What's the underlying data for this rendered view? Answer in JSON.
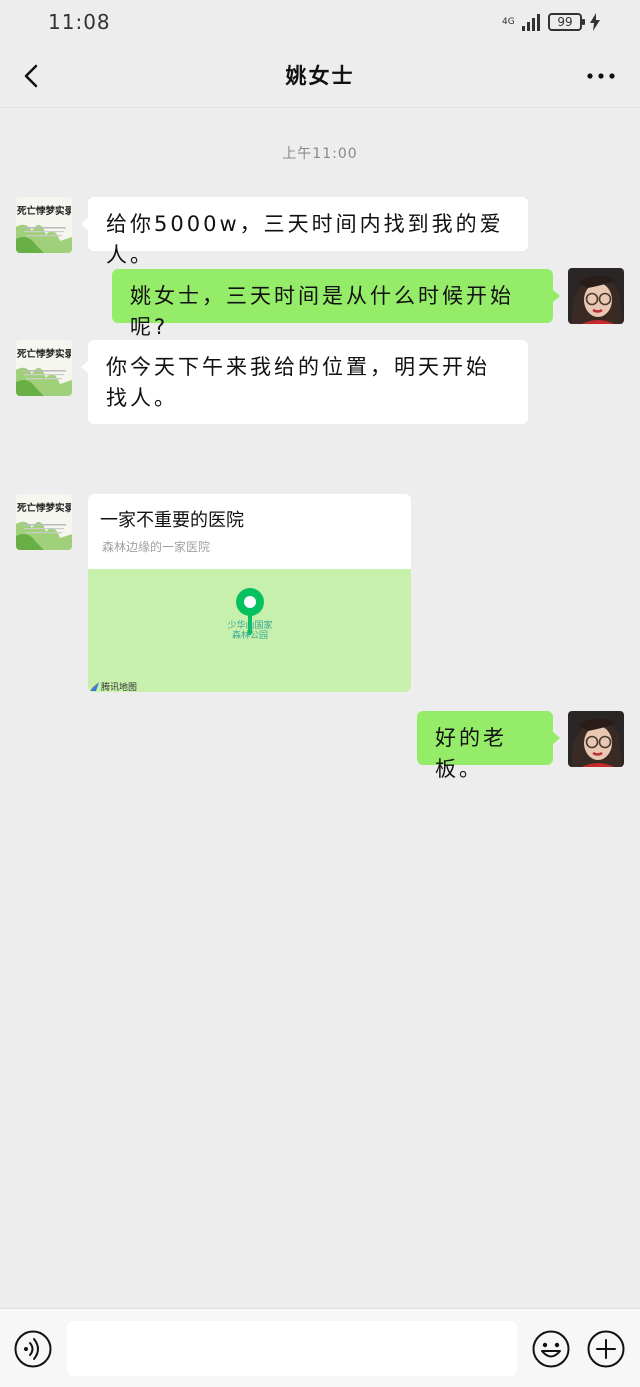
{
  "status_bar": {
    "time": "11:08",
    "network": "4G",
    "battery": "99"
  },
  "header": {
    "title": "姚女士"
  },
  "timestamp": "上午11:00",
  "messages": [
    {
      "side": "left",
      "avatar": "book-cover-avatar",
      "text": "给你5000w，三天时间内找到我的爱人。"
    },
    {
      "side": "right",
      "avatar": "user-avatar",
      "text": "姚女士，三天时间是从什么时候开始呢?"
    },
    {
      "side": "left",
      "avatar": "book-cover-avatar",
      "text": "你今天下午来我给的位置，明天开始找人。"
    },
    {
      "side": "left",
      "avatar": "book-cover-avatar",
      "type": "location",
      "location": {
        "title": "一家不重要的医院",
        "subtitle": "森林边缘的一家医院",
        "map_label": "少华山国家森林公园",
        "map_brand": "腾讯地图"
      }
    },
    {
      "side": "right",
      "avatar": "user-avatar",
      "text": "好的老板。"
    }
  ],
  "book_cover": {
    "title": "死亡悖梦实录"
  },
  "colors": {
    "green_bubble": "#95ec69",
    "background": "#ededed",
    "pin": "#07c160"
  },
  "input": {
    "value": ""
  }
}
